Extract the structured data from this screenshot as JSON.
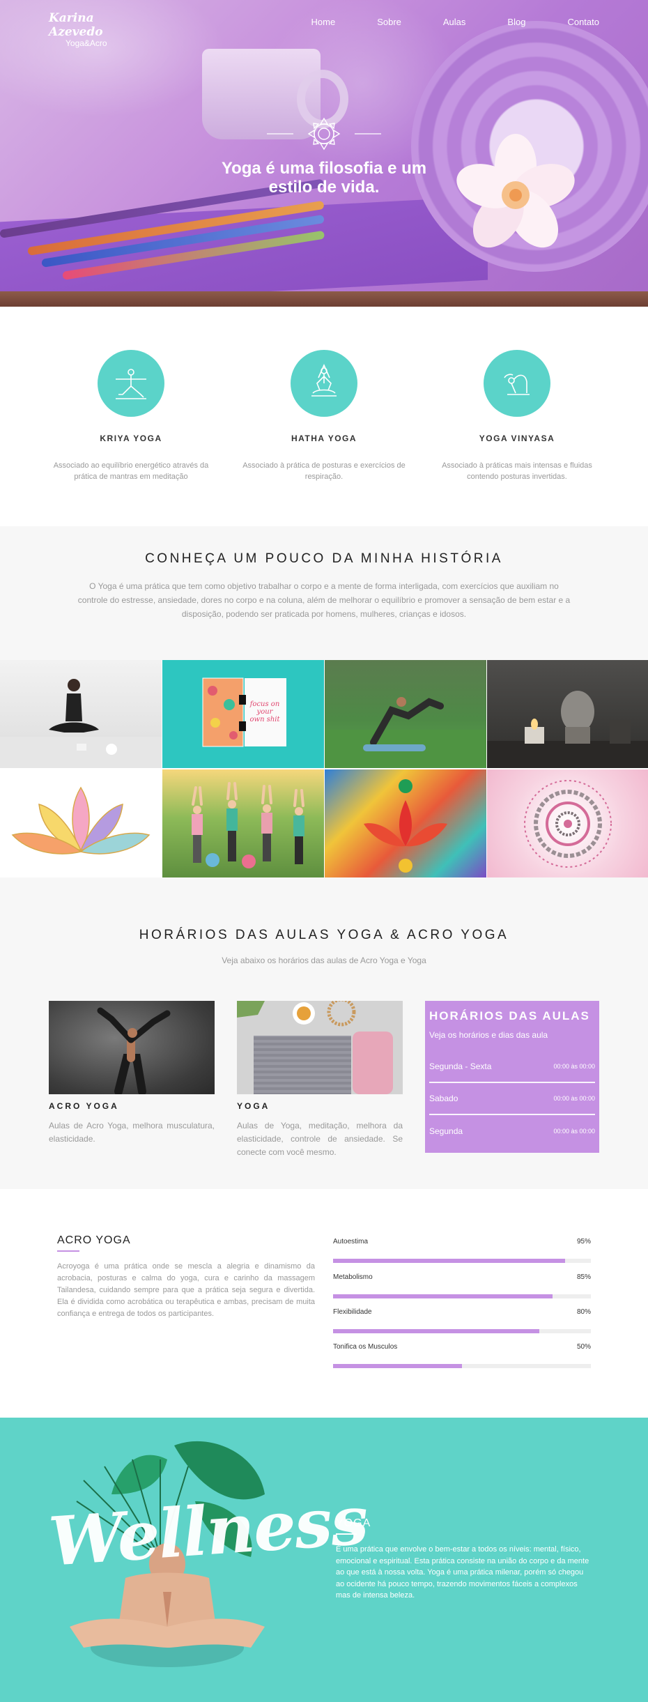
{
  "header": {
    "logo_script": "Karina Azevedo",
    "logo_sub": "Yoga&Acro",
    "nav": [
      "Home",
      "Sobre",
      "Aulas",
      "Blog",
      "Contato"
    ]
  },
  "hero": {
    "title": "Yoga é uma filosofia e um estilo de vida."
  },
  "features": [
    {
      "title": "KRIYA YOGA",
      "desc": "Associado ao equilíbrio energético através da prática de mantras em meditação",
      "icon": "warrior-pose-icon"
    },
    {
      "title": "HATHA YOGA",
      "desc": "Associado à prática de posturas e exercícios de respiração.",
      "icon": "lotus-meditation-icon"
    },
    {
      "title": "YOGA VINYASA",
      "desc": "Associado à práticas mais intensas e fluidas contendo posturas invertidas.",
      "icon": "forward-bend-icon"
    }
  ],
  "history": {
    "title": "CONHEÇA UM POUCO DA MINHA HISTÓRIA",
    "text": "O Yoga é uma prática que tem como objetivo trabalhar o corpo e a mente de forma interligada, com exercícios que auxiliam no controle do estresse, ansiedade, dores no corpo e na coluna, além de melhorar o equilíbrio e promover a sensação de bem estar e a disposição, podendo ser praticada por homens, mulheres, crianças e idosos."
  },
  "gallery": {
    "notebook_text": "focus on your own shit"
  },
  "schedule": {
    "title": "HORÁRIOS DAS AULAS YOGA & ACRO YOGA",
    "subtitle": "Veja abaixo os horários das aulas de Acro Yoga e Yoga",
    "cards": [
      {
        "title": "ACRO YOGA",
        "desc": "Aulas de Acro Yoga, melhora musculatura, elasticidade."
      },
      {
        "title": "YOGA",
        "desc": "Aulas de Yoga, meditação, melhora da elasticidade, controle de ansiedade. Se conecte com você mesmo."
      }
    ],
    "hours": {
      "title": "HORÁRIOS DAS AULAS",
      "subtitle": "Veja os horários e dias das aula",
      "rows": [
        {
          "day": "Segunda - Sexta",
          "time": "00:00 às 00:00"
        },
        {
          "day": "Sabado",
          "time": "00:00 às 00:00"
        },
        {
          "day": "Segunda",
          "time": "00:00 às 00:00"
        }
      ]
    }
  },
  "acro": {
    "title": "ACRO YOGA",
    "text": "Acroyoga é uma prática onde se mescla a alegria e dinamismo da acrobacia, posturas e calma do yoga, cura e carinho da massagem Tailandesa, cuidando sempre para que a prática seja segura e divertida. Ela é dividida como acrobática ou terapêutica e ambas, precisam de muita confiança e entrega de todos os participantes.",
    "skills": [
      {
        "label": "Autoestima",
        "percent": "95%",
        "value": 0.9
      },
      {
        "label": "Metabolismo",
        "percent": "85%",
        "value": 0.85
      },
      {
        "label": "Flexibilidade",
        "percent": "80%",
        "value": 0.8
      },
      {
        "label": "Tonifica os Musculos",
        "percent": "50%",
        "value": 0.5
      }
    ]
  },
  "wellness": {
    "image_text": "Wellness",
    "title": "YOGA",
    "text": "É uma prática que envolve o bem-estar a todos os níveis: mental, físico, emocional e espiritual. Esta prática consiste na união do corpo e da mente ao que está à nossa volta. Yoga é uma prática milenar, porém só chegou ao ocidente há pouco tempo, trazendo movimentos fáceis a complexos mas de intensa beleza."
  },
  "colors": {
    "accent_teal": "#5bd3c9",
    "accent_purple": "#c591e3"
  }
}
